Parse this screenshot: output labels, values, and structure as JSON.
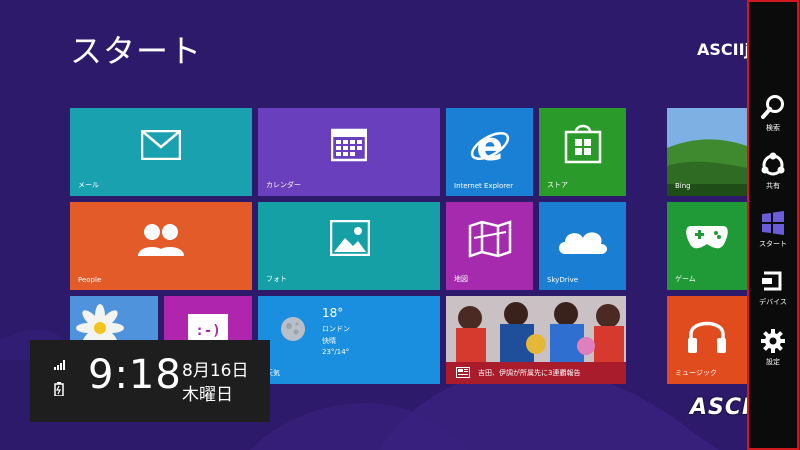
{
  "screen": {
    "title": "スタート",
    "user_name": "ASCIIjp",
    "background_color": "#2d1a6b",
    "accent_color": "#d0191e"
  },
  "tiles": {
    "mail": {
      "label": "メール",
      "icon": "mail-icon"
    },
    "calendar": {
      "label": "カレンダー",
      "icon": "calendar-icon"
    },
    "ie": {
      "label": "Internet Explorer",
      "icon": "internet-explorer-icon"
    },
    "store": {
      "label": "ストア",
      "icon": "store-icon"
    },
    "bing": {
      "label": "Bing",
      "icon": "bing-landscape-image"
    },
    "people": {
      "label": "People",
      "icon": "people-icon"
    },
    "photo": {
      "label": "フォト",
      "icon": "photo-icon"
    },
    "maps": {
      "label": "地図",
      "icon": "map-icon"
    },
    "skydrive": {
      "label": "SkyDrive",
      "icon": "cloud-icon"
    },
    "games": {
      "label": "ゲーム",
      "icon": "gamepad-icon"
    },
    "desktop": {
      "icon": "desktop-flower-image"
    },
    "messaging": {
      "icon": "messaging-smiley-icon"
    },
    "weather": {
      "label": "天気",
      "temperature": "18°",
      "city": "ロンドン",
      "condition": "快晴",
      "range": "23°/14°",
      "icon": "moon-icon"
    },
    "news": {
      "headline": "吉田、伊調が所属先に3連覇報告",
      "icon": "news-icon"
    },
    "music": {
      "label": "ミュージック",
      "icon": "headphones-icon"
    }
  },
  "clock": {
    "time": "9:18",
    "date": "8月16日",
    "weekday": "木曜日",
    "icons": [
      "signal-icon",
      "battery-icon"
    ]
  },
  "watermark": "ASCII",
  "charms": {
    "search": {
      "label": "検索",
      "icon": "search-icon"
    },
    "share": {
      "label": "共有",
      "icon": "share-icon"
    },
    "start": {
      "label": "スタート",
      "icon": "windows-icon"
    },
    "devices": {
      "label": "デバイス",
      "icon": "devices-icon"
    },
    "settings": {
      "label": "設定",
      "icon": "gear-icon"
    }
  }
}
